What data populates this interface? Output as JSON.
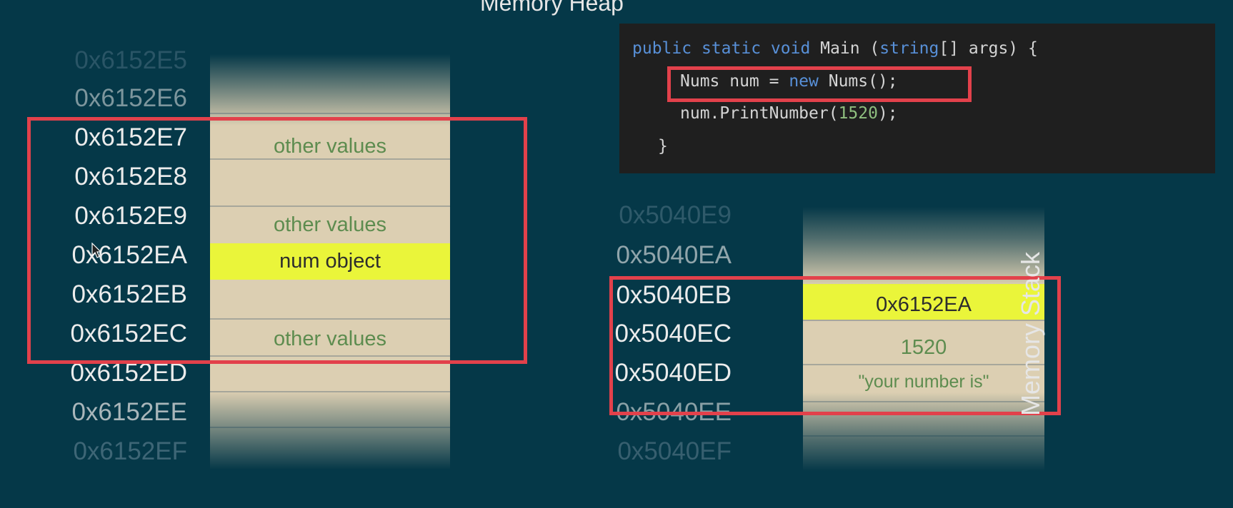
{
  "heap": {
    "title": "Memory Heap",
    "addresses": [
      "0x6152E5",
      "0x6152E6",
      "0x6152E7",
      "0x6152E8",
      "0x6152E9",
      "0x6152EA",
      "0x6152EB",
      "0x6152EC",
      "0x6152ED",
      "0x6152EE",
      "0x6152EF"
    ],
    "cells": {
      "e7": "other values",
      "e9": "other values",
      "ea": "num object",
      "ec": "other values"
    }
  },
  "code": {
    "l1": {
      "kw1": "public",
      "kw2": "static",
      "kw3": "void",
      "name": "Main",
      "p1": "(",
      "type": "string",
      "rest": "[] args) {"
    },
    "l2": {
      "a": "Nums num = ",
      "kw": "new",
      "b": " Nums();"
    },
    "l3": {
      "a": "num.PrintNumber(",
      "num": "1520",
      "b": ");"
    },
    "l4": "}"
  },
  "stack": {
    "title": "Memory Stack",
    "addresses": [
      "0x5040E9",
      "0x5040EA",
      "0x5040EB",
      "0x5040EC",
      "0x5040ED",
      "0x5040EE",
      "0x5040EF"
    ],
    "cells": {
      "eb": "0x6152EA",
      "ec": "1520",
      "ed": "\"your number is\""
    }
  },
  "colors": {
    "background": "#053848",
    "cell": "#dccfb2",
    "highlight": "#eaf53a",
    "highlight_border": "#e2414b",
    "value_text": "#5d8c4f"
  }
}
